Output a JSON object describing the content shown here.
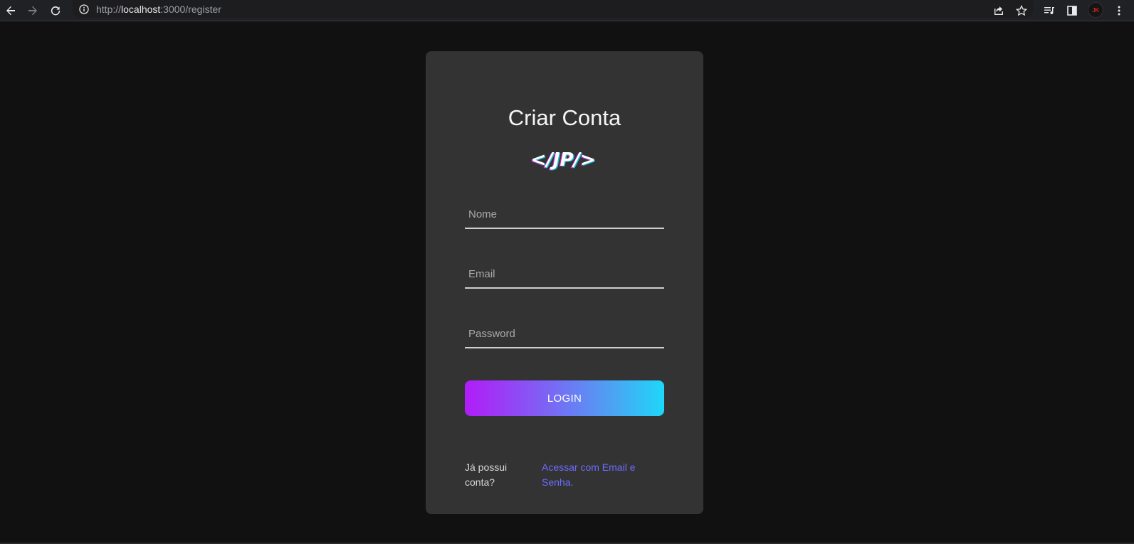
{
  "browser": {
    "url_scheme": "http://",
    "url_host": "localhost",
    "url_path": ":3000/register",
    "avatar_text": "JK"
  },
  "card": {
    "title": "Criar Conta",
    "logo_text": "</JP/>",
    "fields": {
      "name_placeholder": "Nome",
      "email_placeholder": "Email",
      "password_placeholder": "Password"
    },
    "button_label": "LOGIN",
    "footer_question": "Já possui conta?",
    "footer_link": "Acessar com Email e Senha."
  },
  "colors": {
    "page_bg": "#111111",
    "card_bg": "#333333",
    "gradient_start": "#b11cf7",
    "gradient_end": "#1ed7f9",
    "link": "#6c6cff"
  }
}
